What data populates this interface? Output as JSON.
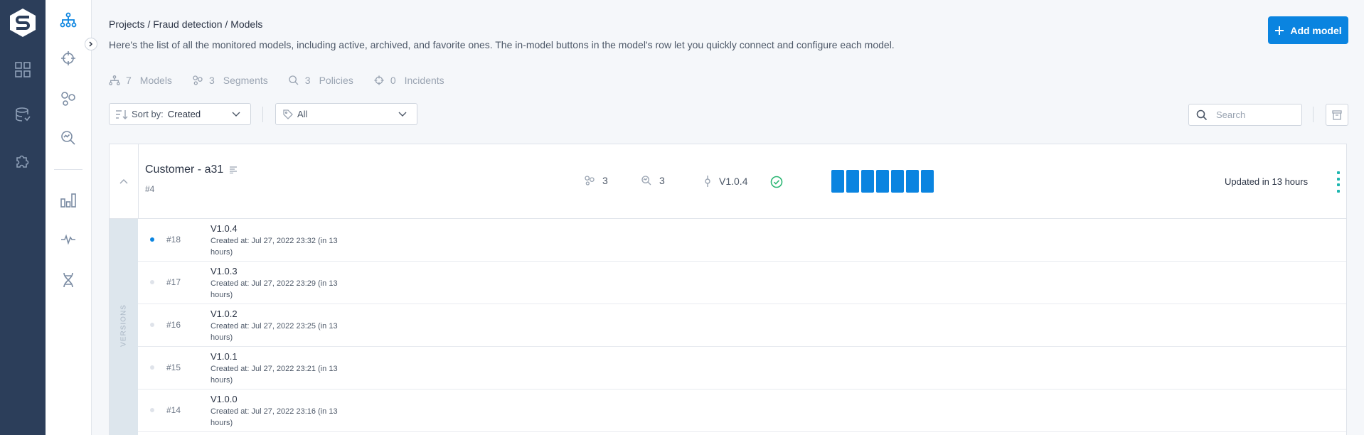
{
  "breadcrumb": "Projects / Fraud detection / Models",
  "description": "Here's the list of all the monitored models, including active, archived, and favorite ones. The in-model buttons in the model's row let you quickly connect and configure each model.",
  "add_button_label": "Add model",
  "stats": [
    {
      "icon": "models-icon",
      "count": "7",
      "label": "Models"
    },
    {
      "icon": "segments-icon",
      "count": "3",
      "label": "Segments"
    },
    {
      "icon": "policies-icon",
      "count": "3",
      "label": "Policies"
    },
    {
      "icon": "incidents-icon",
      "count": "0",
      "label": "Incidents"
    }
  ],
  "sort": {
    "prefix": "Sort by:",
    "value": "Created"
  },
  "filter": {
    "value": "All"
  },
  "search": {
    "placeholder": "Search"
  },
  "model": {
    "name": "Customer - a31",
    "id": "#4",
    "segments": "3",
    "policies": "3",
    "version": "V1.0.4",
    "updated": "Updated in 13 hours",
    "bar_count": 7
  },
  "versions_label": "VERSIONS",
  "versions": [
    {
      "id": "#18",
      "name": "V1.0.4",
      "created": "Created at: Jul 27, 2022 23:32 (in 13 hours)",
      "active": true
    },
    {
      "id": "#17",
      "name": "V1.0.3",
      "created": "Created at: Jul 27, 2022 23:29 (in 13 hours)",
      "active": false
    },
    {
      "id": "#16",
      "name": "V1.0.2",
      "created": "Created at: Jul 27, 2022 23:25 (in 13 hours)",
      "active": false
    },
    {
      "id": "#15",
      "name": "V1.0.1",
      "created": "Created at: Jul 27, 2022 23:21 (in 13 hours)",
      "active": false
    },
    {
      "id": "#14",
      "name": "V1.0.0",
      "created": "Created at: Jul 27, 2022 23:16 (in 13 hours)",
      "active": false
    }
  ],
  "colors": {
    "accent": "#0a84e0",
    "rail": "#2c3e5a",
    "success": "#2bb673",
    "kebab": "#1fb6b0"
  }
}
